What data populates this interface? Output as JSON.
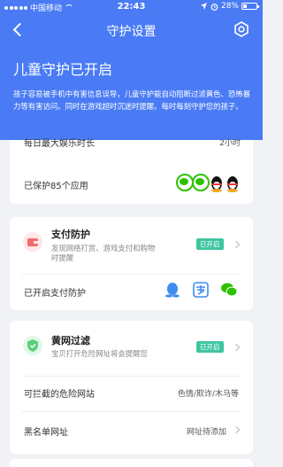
{
  "status_bar": {
    "carrier": "中国移动",
    "time": "22:43",
    "battery": "28%"
  },
  "nav": {
    "title": "守护设置"
  },
  "protection": {
    "title": "儿童守护已开启",
    "description": "孩子容易被手机中有害信息误导，儿童守护能自动阻断过滤黄色、恐怖暴力等有害访问。同时在游戏超时沉迷时提醒。每时每刻守护您的孩子。"
  },
  "entertainment": {
    "daily_limit_label": "每日最大娱乐时长",
    "daily_limit_value": "2小时",
    "protected_apps_label": "已保护85个应用"
  },
  "payment": {
    "title": "支付防护",
    "description": "发现网络打赏、游戏支付和购物时提醒",
    "status": "已开启",
    "enabled_label": "已开启支付防护"
  },
  "filter": {
    "title": "黄网过滤",
    "description": "宝贝打开危险网址将会提醒您",
    "status": "已开启",
    "blockable_label": "可拦截的危险网站",
    "blockable_value": "色情/欺诈/木马等",
    "blacklist_label": "黑名单网址",
    "blacklist_value": "网址待添加"
  },
  "colors": {
    "primary": "#4a7bf5",
    "badge": "#3fc5a0",
    "payment_icon": "#f36a6a",
    "filter_icon": "#5bcf7c"
  }
}
